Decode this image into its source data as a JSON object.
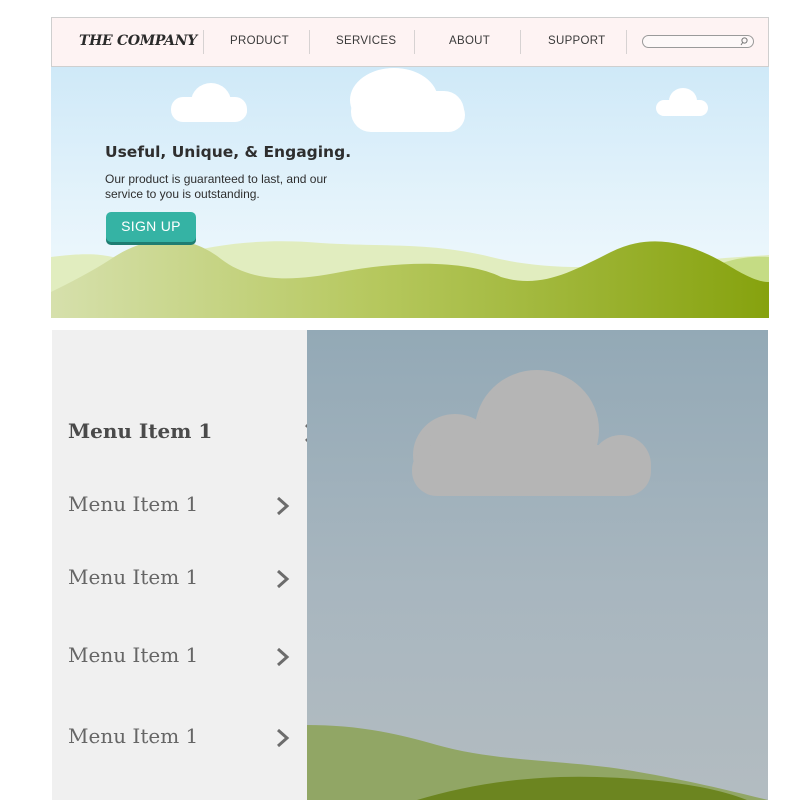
{
  "header": {
    "brand": "THE COMPANY",
    "nav": [
      {
        "label": "PRODUCT"
      },
      {
        "label": "SERVICES"
      },
      {
        "label": "ABOUT"
      },
      {
        "label": "SUPPORT"
      }
    ],
    "search": {
      "placeholder": "",
      "icon": "search-icon"
    }
  },
  "hero": {
    "title": "Useful, Unique, & Engaging.",
    "text": "Our product is guaranteed to last, and our service to you is outstanding.",
    "button_label": "SIGN UP",
    "colors": {
      "button": "#35b3a4",
      "sky": "#cfe9f8",
      "hill": "#8aa61a"
    }
  },
  "menu": {
    "items": [
      {
        "label": "Menu Item 1",
        "active": true
      },
      {
        "label": "Menu Item 1",
        "active": false
      },
      {
        "label": "Menu Item 1",
        "active": false
      },
      {
        "label": "Menu Item 1",
        "active": false
      },
      {
        "label": "Menu Item 1",
        "active": false
      }
    ],
    "chevron_icon": "chevron-right-icon"
  },
  "picture": {
    "description_icon": "landscape-image"
  }
}
